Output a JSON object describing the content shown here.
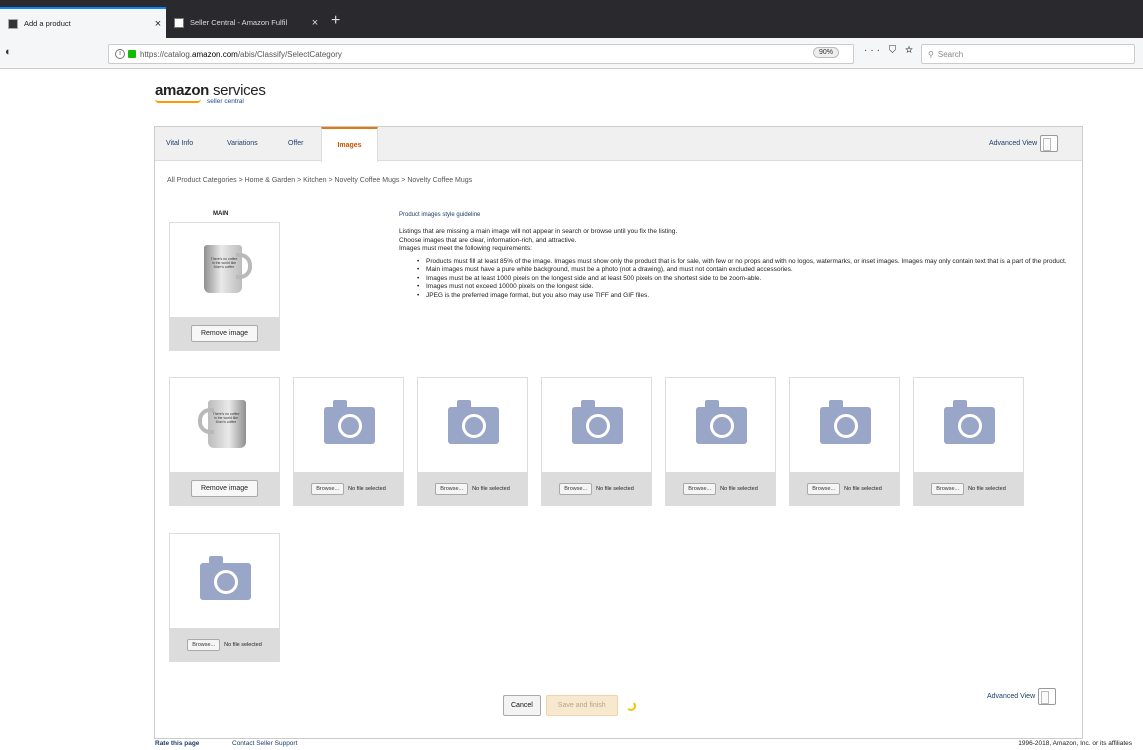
{
  "browser": {
    "tabs": [
      {
        "title": "Add a product",
        "active": true
      },
      {
        "title": "Seller Central - Amazon Fulfil",
        "active": false
      }
    ],
    "new_tab_icon": "+",
    "close_icon": "×",
    "url_prefix": "https://catalog.",
    "url_host": "amazon.com",
    "url_path": "/abis/Classify/SelectCategory",
    "zoom": "90%",
    "page_actions": "··· ⛉ ☆",
    "search_placeholder": "Search"
  },
  "logo": {
    "main": "amazon",
    "services": "services",
    "sub": "seller central"
  },
  "tabs": [
    {
      "label": "Vital Info",
      "active": false
    },
    {
      "label": "Variations",
      "active": false
    },
    {
      "label": "Offer",
      "active": false
    },
    {
      "label": "Images",
      "active": true
    }
  ],
  "advanced_view_label": "Advanced View",
  "breadcrumb": "All Product Categories > Home & Garden > Kitchen > Novelty Coffee Mugs > Novelty Coffee Mugs",
  "main_label": "MAIN",
  "mug_text": "There's no coffee in the world like Mom's coffee",
  "remove_image_label": "Remove image",
  "browse_label": "Browse...",
  "no_file_label": "No file selected",
  "guidelines": {
    "title": "Product images style guideline",
    "intro": [
      "Listings that are missing a main image will not appear in search or browse until you fix the listing.",
      "Choose images that are clear, information-rich, and attractive.",
      "Images must meet the following requirements:"
    ],
    "requirements": [
      "Products must fill at least 85% of the image. Images must show only the product that is for sale, with few or no props and with no logos, watermarks, or inset images. Images may only contain text that is a part of the product.",
      "Main images must have a pure white background, must be a photo (not a drawing), and must not contain excluded accessories.",
      "Images must be at least 1000 pixels on the longest side and at least 500 pixels on the shortest side to be zoom-able.",
      "Images must not exceed 10000 pixels on the longest side.",
      "JPEG is the preferred image format, but you also may use TIFF and GIF files."
    ]
  },
  "actions": {
    "cancel": "Cancel",
    "save": "Save and finish"
  },
  "footer": {
    "rate": "Rate this page",
    "contact": "Contact Seller Support",
    "copyright": "1996-2018, Amazon, Inc. or its affiliates"
  }
}
